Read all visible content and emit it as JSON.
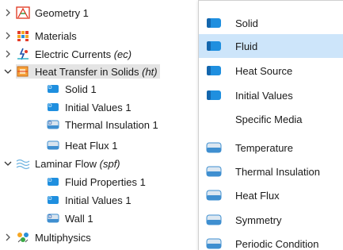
{
  "tree": {
    "items": [
      {
        "label": "Geometry 1",
        "suffix": "",
        "icon": "geometry-icon"
      },
      {
        "label": "Materials",
        "suffix": "",
        "icon": "materials-icon"
      },
      {
        "label": "Electric Currents ",
        "suffix": "(ec)",
        "icon": "electric-currents-icon"
      },
      {
        "label": "Heat Transfer in Solids ",
        "suffix": "(ht)",
        "icon": "heat-transfer-icon"
      },
      {
        "label": "Solid 1",
        "suffix": "",
        "icon": "solid-node-icon"
      },
      {
        "label": "Initial Values 1",
        "suffix": "",
        "icon": "initial-values-node-icon"
      },
      {
        "label": "Thermal Insulation 1",
        "suffix": "",
        "icon": "thermal-insulation-node-icon"
      },
      {
        "label": "Heat Flux 1",
        "suffix": "",
        "icon": "heat-flux-node-icon"
      },
      {
        "label": "Laminar Flow ",
        "suffix": "(spf)",
        "icon": "laminar-flow-icon"
      },
      {
        "label": "Fluid Properties 1",
        "suffix": "",
        "icon": "fluid-properties-node-icon"
      },
      {
        "label": "Initial Values 1",
        "suffix": "",
        "icon": "initial-values-node-icon"
      },
      {
        "label": "Wall 1",
        "suffix": "",
        "icon": "wall-node-icon"
      },
      {
        "label": "Multiphysics",
        "suffix": "",
        "icon": "multiphysics-icon"
      }
    ]
  },
  "menu": {
    "items": [
      {
        "label": "Solid",
        "icon": "domain-icon"
      },
      {
        "label": "Fluid",
        "icon": "domain-icon",
        "hovered": true
      },
      {
        "label": "Heat Source",
        "icon": "domain-icon"
      },
      {
        "label": "Initial Values",
        "icon": "domain-icon"
      },
      {
        "label": "Specific Media",
        "icon": ""
      },
      {
        "label": "Temperature",
        "icon": "boundary-icon"
      },
      {
        "label": "Thermal Insulation",
        "icon": "boundary-icon"
      },
      {
        "label": "Heat Flux",
        "icon": "boundary-icon"
      },
      {
        "label": "Symmetry",
        "icon": "boundary-icon"
      },
      {
        "label": "Periodic Condition",
        "icon": "boundary-icon"
      }
    ]
  },
  "colors": {
    "menu_hover": "#cde5fa",
    "domain_icon": "#1f8fdf",
    "boundary_icon": "#3f8fd0",
    "selected_row": "#e4e4e4"
  }
}
